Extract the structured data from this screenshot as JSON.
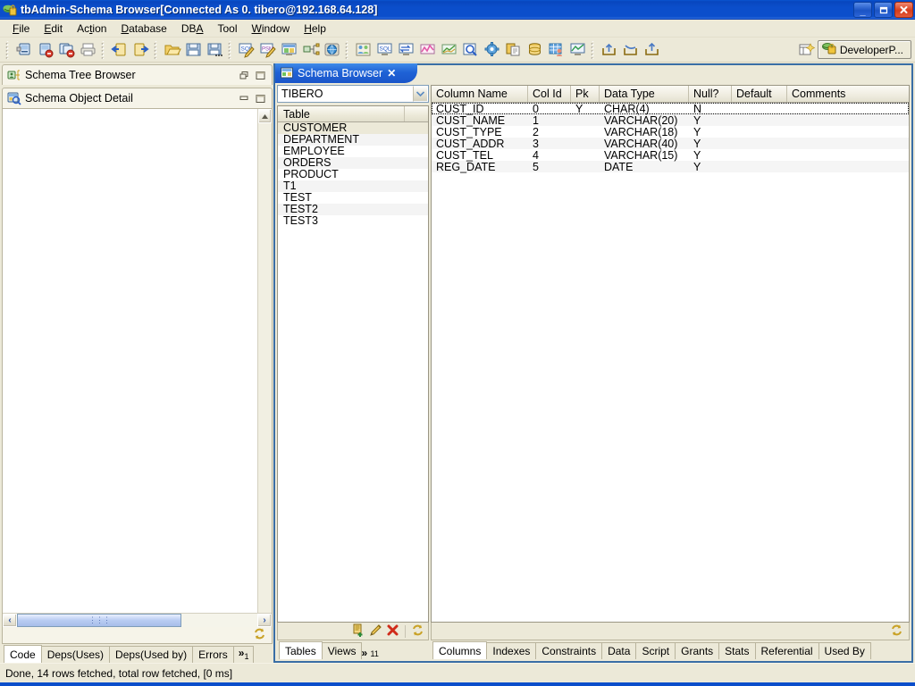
{
  "window": {
    "title": "tbAdmin-Schema Browser[Connected As 0. tibero@192.168.64.128]",
    "minimize_label": "_",
    "maximize_label": "❐",
    "close_label": "✕"
  },
  "menubar": {
    "items": [
      {
        "label": "File",
        "accel": "F"
      },
      {
        "label": "Edit",
        "accel": "E"
      },
      {
        "label": "Action",
        "accel": "A"
      },
      {
        "label": "Database",
        "accel": "D"
      },
      {
        "label": "DBA",
        "accel": "A"
      },
      {
        "label": "Tool",
        "accel": "T"
      },
      {
        "label": "Window",
        "accel": "W"
      },
      {
        "label": "Help",
        "accel": "H"
      }
    ]
  },
  "toolbar": {
    "groups": [
      [
        "new-connection-icon",
        "disconnect-icon",
        "disconnect-all-icon",
        "print-icon"
      ],
      [
        "previous-object-icon",
        "next-object-icon"
      ],
      [
        "open-file-icon",
        "save-icon",
        "save-as-icon"
      ],
      [
        "new-sql-icon",
        "new-psm-icon",
        "schema-browser-icon",
        "schema-tree-icon",
        "web-browser-icon"
      ],
      [
        "user-manager-icon",
        "sql-monitor-icon",
        "session-monitor-icon",
        "performance-chart-icon",
        "statistics-chart-icon",
        "object-search-icon",
        "settings-icon",
        "copy-object-icon",
        "tablespace-icon",
        "data-grid-user-icon",
        "monitor-chart-icon"
      ],
      [
        "export-icon",
        "import-icon",
        "load-icon"
      ]
    ],
    "perspective_button": {
      "label": "DeveloperP...",
      "icon": "developer-perspective-icon"
    },
    "open_perspective_icon": "open-perspective-icon"
  },
  "left_panel": {
    "schema_tree_browser": {
      "title": "Schema Tree Browser",
      "icon": "schema-tree-icon",
      "restore_label": "❐",
      "maximize_label": "☐"
    },
    "schema_object_detail": {
      "title": "Schema Object Detail",
      "icon": "schema-object-detail-icon",
      "minimize_label": "–",
      "maximize_label": "☐",
      "refresh_icon": "refresh-icon",
      "hscroll": {
        "left_label": "‹",
        "right_label": "›",
        "grip": "‖‖"
      },
      "vscroll": {
        "up_label": "▲",
        "down_label": "▼"
      },
      "tabs": [
        {
          "label": "Code",
          "selected": true
        },
        {
          "label": "Deps(Uses)",
          "selected": false
        },
        {
          "label": "Deps(Used by)",
          "selected": false
        },
        {
          "label": "Errors",
          "selected": false
        }
      ],
      "overflow": {
        "chevron": "»",
        "count": "1"
      }
    }
  },
  "editor": {
    "tab": {
      "label": "Schema Browser",
      "icon": "schema-browser-icon",
      "close_label": "✕"
    },
    "schema_combo": {
      "value": "TIBERO",
      "arrow": "▾"
    },
    "object_list": {
      "header": "Table",
      "rows": [
        {
          "name": "CUSTOMER",
          "selected": true
        },
        {
          "name": "DEPARTMENT",
          "selected": false
        },
        {
          "name": "EMPLOYEE",
          "selected": false
        },
        {
          "name": "ORDERS",
          "selected": false
        },
        {
          "name": "PRODUCT",
          "selected": false
        },
        {
          "name": "T1",
          "selected": false
        },
        {
          "name": "TEST",
          "selected": false
        },
        {
          "name": "TEST2",
          "selected": false
        },
        {
          "name": "TEST3",
          "selected": false
        }
      ],
      "actions": [
        {
          "name": "add-table-icon"
        },
        {
          "name": "edit-table-icon"
        },
        {
          "name": "delete-table-icon"
        },
        {
          "name": "refresh-icon"
        }
      ],
      "tabs": [
        {
          "label": "Tables",
          "selected": true
        },
        {
          "label": "Views",
          "selected": false
        }
      ],
      "overflow": {
        "chevron": "»",
        "count": "11"
      }
    },
    "grid": {
      "columns": [
        "Column Name",
        "Col Id",
        "Pk",
        "Data Type",
        "Null?",
        "Default",
        "Comments"
      ],
      "rows": [
        {
          "cells": [
            "CUST_ID",
            "0",
            "Y",
            "CHAR(4)",
            "N",
            "",
            ""
          ],
          "focused": true
        },
        {
          "cells": [
            "CUST_NAME",
            "1",
            "",
            "VARCHAR(20)",
            "Y",
            "",
            ""
          ],
          "focused": false
        },
        {
          "cells": [
            "CUST_TYPE",
            "2",
            "",
            "VARCHAR(18)",
            "Y",
            "",
            ""
          ],
          "focused": false
        },
        {
          "cells": [
            "CUST_ADDR",
            "3",
            "",
            "VARCHAR(40)",
            "Y",
            "",
            ""
          ],
          "focused": false
        },
        {
          "cells": [
            "CUST_TEL",
            "4",
            "",
            "VARCHAR(15)",
            "Y",
            "",
            ""
          ],
          "focused": false
        },
        {
          "cells": [
            "REG_DATE",
            "5",
            "",
            "DATE",
            "Y",
            "",
            ""
          ],
          "focused": false
        }
      ],
      "refresh_icon": "refresh-icon",
      "tabs": [
        {
          "label": "Columns",
          "selected": true
        },
        {
          "label": "Indexes",
          "selected": false
        },
        {
          "label": "Constraints",
          "selected": false
        },
        {
          "label": "Data",
          "selected": false
        },
        {
          "label": "Script",
          "selected": false
        },
        {
          "label": "Grants",
          "selected": false
        },
        {
          "label": "Stats",
          "selected": false
        },
        {
          "label": "Referential",
          "selected": false
        },
        {
          "label": "Used By",
          "selected": false
        }
      ]
    }
  },
  "statusbar": {
    "message": "Done, 14 rows fetched, total row fetched, [0 ms]"
  },
  "colors": {
    "titlebar_blue": "#0b4ecb",
    "chrome": "#ece9d8",
    "tab_active_blue": "#1f62d6",
    "editor_border": "#3a6ea5"
  }
}
